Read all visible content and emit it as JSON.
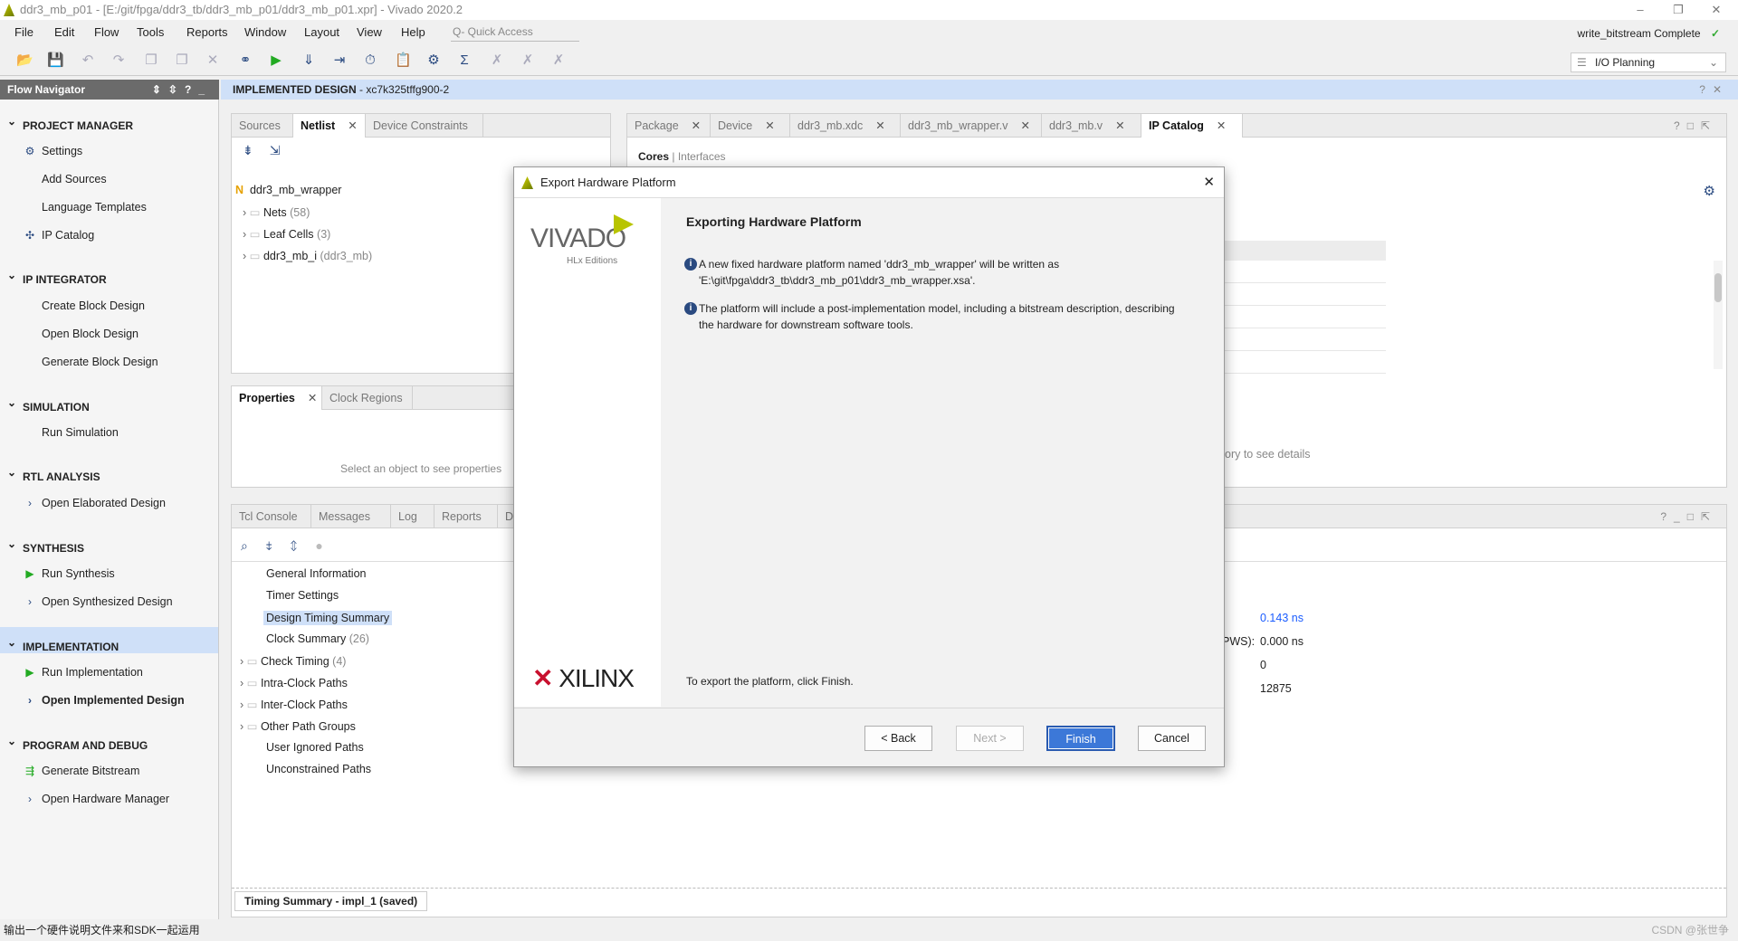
{
  "window": {
    "title": "ddr3_mb_p01 - [E:/git/fpga/ddr3_tb/ddr3_mb_p01/ddr3_mb_p01.xpr] - Vivado 2020.2"
  },
  "menu": [
    "File",
    "Edit",
    "Flow",
    "Tools",
    "Reports",
    "Window",
    "Layout",
    "View",
    "Help"
  ],
  "quick_access_placeholder": "Q- Quick Access",
  "status": {
    "text": "write_bitstream Complete",
    "layout": "I/O Planning"
  },
  "flow_navigator": {
    "title": "Flow Navigator",
    "sections": [
      {
        "label": "PROJECT MANAGER",
        "items": [
          {
            "label": "Settings",
            "icon": "gear-icon"
          },
          {
            "label": "Add Sources"
          },
          {
            "label": "Language Templates"
          },
          {
            "label": "IP Catalog",
            "icon": "ip-icon"
          }
        ]
      },
      {
        "label": "IP INTEGRATOR",
        "items": [
          {
            "label": "Create Block Design"
          },
          {
            "label": "Open Block Design"
          },
          {
            "label": "Generate Block Design"
          }
        ]
      },
      {
        "label": "SIMULATION",
        "items": [
          {
            "label": "Run Simulation"
          }
        ]
      },
      {
        "label": "RTL ANALYSIS",
        "items": [
          {
            "label": "Open Elaborated Design",
            "icon": "chevron-right-icon"
          }
        ]
      },
      {
        "label": "SYNTHESIS",
        "items": [
          {
            "label": "Run Synthesis",
            "icon": "play-icon"
          },
          {
            "label": "Open Synthesized Design",
            "icon": "chevron-right-icon"
          }
        ]
      },
      {
        "label": "IMPLEMENTATION",
        "items": [
          {
            "label": "Run Implementation",
            "icon": "play-icon"
          },
          {
            "label": "Open Implemented Design",
            "icon": "chevron-right-icon"
          }
        ]
      },
      {
        "label": "PROGRAM AND DEBUG",
        "items": [
          {
            "label": "Generate Bitstream",
            "icon": "bitstream-icon"
          },
          {
            "label": "Open Hardware Manager",
            "icon": "chevron-right-icon"
          }
        ]
      }
    ]
  },
  "main_header": {
    "title": "IMPLEMENTED DESIGN",
    "part": " - xc7k325tffg900-2"
  },
  "sources_panel": {
    "tabs": [
      "Sources",
      "Netlist",
      "Device Constraints"
    ],
    "active": "Netlist",
    "root": "ddr3_mb_wrapper",
    "nodes": [
      {
        "label": "Nets",
        "count": "(58)"
      },
      {
        "label": "Leaf Cells",
        "count": "(3)"
      },
      {
        "label": "ddr3_mb_i",
        "count": "(ddr3_mb)"
      }
    ]
  },
  "properties_panel": {
    "tabs": [
      "Properties",
      "Clock Regions"
    ],
    "empty": "Select an object to see properties"
  },
  "console_panel": {
    "tabs": [
      "Tcl Console",
      "Messages",
      "Log",
      "Reports",
      "Des"
    ],
    "items": [
      {
        "label": "General Information"
      },
      {
        "label": "Timer Settings"
      },
      {
        "label": "Design Timing Summary",
        "selected": true
      },
      {
        "label": "Clock Summary",
        "count": "(26)"
      },
      {
        "label": "Check Timing",
        "count": "(4)",
        "expandable": true
      },
      {
        "label": "Intra-Clock Paths",
        "expandable": true
      },
      {
        "label": "Inter-Clock Paths",
        "expandable": true
      },
      {
        "label": "Other Path Groups",
        "expandable": true
      },
      {
        "label": "User Ignored Paths"
      },
      {
        "label": "Unconstrained Paths"
      }
    ],
    "footer_tab": "Timing Summary - impl_1 (saved)"
  },
  "editor_panel": {
    "tabs": [
      "Package",
      "Device",
      "ddr3_mb.xdc",
      "ddr3_mb_wrapper.v",
      "ddr3_mb.v",
      "IP Catalog"
    ],
    "active": "IP Catalog",
    "subtabs": [
      "Cores",
      "Interfaces"
    ],
    "details_hint": "ory to see details"
  },
  "timing_values": {
    "wns": "0.143 ns",
    "pws_label": "PWS):",
    "pws": "0.000 ns",
    "failing": "0",
    "endpoints": "12875"
  },
  "dialog": {
    "title": "Export Hardware Platform",
    "heading": "Exporting Hardware Platform",
    "info1_line1": "A new fixed hardware platform named 'ddr3_mb_wrapper' will be written as",
    "info1_line2": "'E:\\git\\fpga\\ddr3_tb\\ddr3_mb_p01\\ddr3_mb_wrapper.xsa'.",
    "info2_line1": "The platform will include a post-implementation model, including a bitstream description, describing",
    "info2_line2": "the hardware for downstream software tools.",
    "footer": "To export the platform, click Finish.",
    "logo_vivado": "VIVADO",
    "logo_sub": "HLx Editions",
    "logo_xilinx": "XILINX",
    "buttons": {
      "back": "< Back",
      "next": "Next >",
      "finish": "Finish",
      "cancel": "Cancel"
    }
  },
  "statusbar": {
    "text": "输出一个硬件说明文件来和SDK一起运用",
    "watermark": "CSDN @张世争"
  },
  "colors": {
    "accent": "#3c78d8",
    "header_blue": "#cfe0f8",
    "link": "#1a5cff"
  }
}
